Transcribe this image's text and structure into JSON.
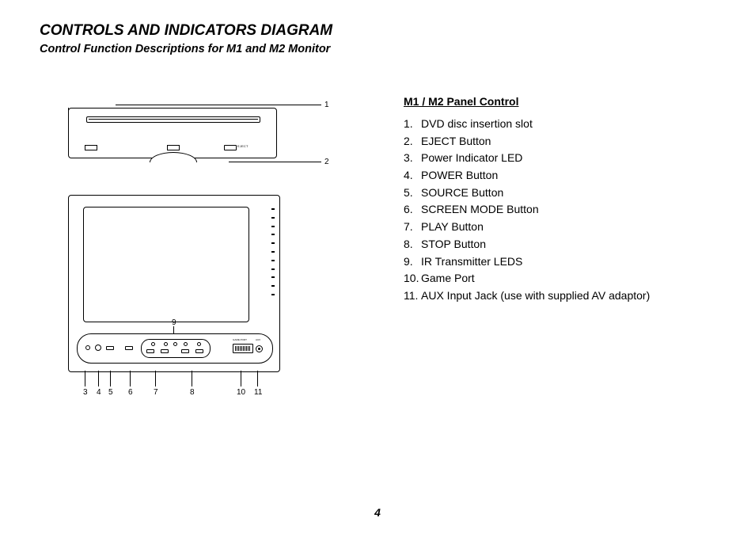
{
  "title": "CONTROLS AND INDICATORS DIAGRAM",
  "subtitle": "Control Function Descriptions for M1 and M2 Monitor",
  "page_number": "4",
  "panel_heading": "M1 / M2 Panel Control",
  "top_diagram": {
    "eject_label": "EJECT",
    "callouts": {
      "slot": "1",
      "eject": "2"
    }
  },
  "bottom_diagram": {
    "game_port_label": "GAME PORT",
    "aux_label": "AUX",
    "center_callout": "9",
    "bottom_callouts": [
      "3",
      "4",
      "5",
      "6",
      "7",
      "8",
      "10",
      "11"
    ]
  },
  "controls": [
    {
      "n": "1.",
      "text": "DVD disc insertion slot"
    },
    {
      "n": "2.",
      "text": "EJECT Button"
    },
    {
      "n": "3.",
      "text": "Power Indicator LED"
    },
    {
      "n": "4.",
      "text": "POWER Button"
    },
    {
      "n": "5.",
      "text": "SOURCE Button"
    },
    {
      "n": "6.",
      "text": "SCREEN MODE Button"
    },
    {
      "n": "7.",
      "text": "PLAY Button"
    },
    {
      "n": "8.",
      "text": "STOP Button"
    },
    {
      "n": "9.",
      "text": "IR Transmitter LEDS"
    },
    {
      "n": "10.",
      "text": "Game Port"
    },
    {
      "n": "11.",
      "text": "AUX Input Jack (use with supplied AV adaptor)"
    }
  ]
}
